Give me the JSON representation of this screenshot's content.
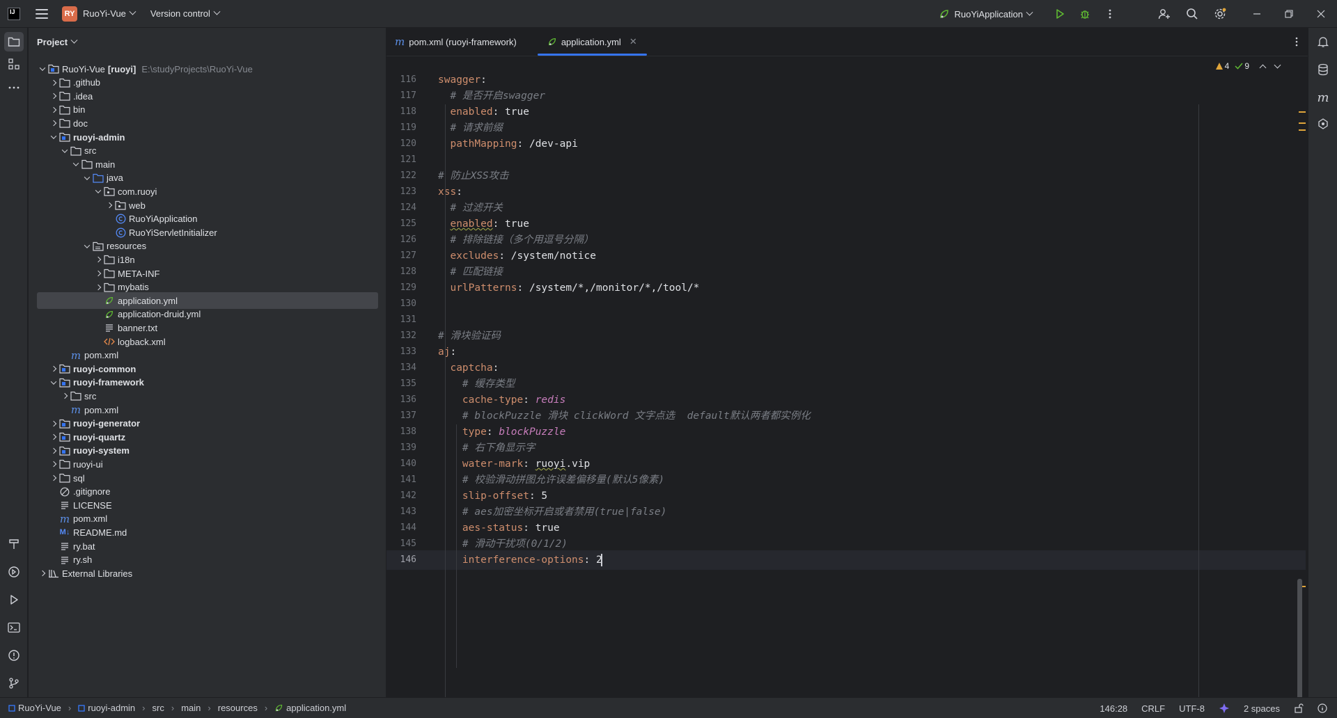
{
  "titlebar": {
    "project_badge": "RY",
    "project_name": "RuoYi-Vue",
    "vcs": "Version control",
    "run_config": "RuoYiApplication"
  },
  "project_panel": {
    "title": "Project",
    "root_name": "RuoYi-Vue",
    "root_module": "[ruoyi]",
    "root_path": "E:\\studyProjects\\RuoYi-Vue",
    "items": [
      {
        "label": ".github",
        "type": "folder"
      },
      {
        "label": ".idea",
        "type": "folder"
      },
      {
        "label": "bin",
        "type": "folder"
      },
      {
        "label": "doc",
        "type": "folder"
      },
      {
        "label": "ruoyi-admin",
        "type": "module"
      },
      {
        "label": "src",
        "type": "folder"
      },
      {
        "label": "main",
        "type": "folder"
      },
      {
        "label": "java",
        "type": "source-folder"
      },
      {
        "label": "com.ruoyi",
        "type": "package"
      },
      {
        "label": "web",
        "type": "package"
      },
      {
        "label": "RuoYiApplication",
        "type": "class"
      },
      {
        "label": "RuoYiServletInitializer",
        "type": "class"
      },
      {
        "label": "resources",
        "type": "resource-folder"
      },
      {
        "label": "i18n",
        "type": "folder"
      },
      {
        "label": "META-INF",
        "type": "folder"
      },
      {
        "label": "mybatis",
        "type": "folder"
      },
      {
        "label": "application.yml",
        "type": "yml"
      },
      {
        "label": "application-druid.yml",
        "type": "yml"
      },
      {
        "label": "banner.txt",
        "type": "text"
      },
      {
        "label": "logback.xml",
        "type": "xml"
      },
      {
        "label": "pom.xml",
        "type": "maven"
      },
      {
        "label": "ruoyi-common",
        "type": "module"
      },
      {
        "label": "ruoyi-framework",
        "type": "module"
      },
      {
        "label": "src",
        "type": "folder"
      },
      {
        "label": "pom.xml",
        "type": "maven"
      },
      {
        "label": "ruoyi-generator",
        "type": "module"
      },
      {
        "label": "ruoyi-quartz",
        "type": "module"
      },
      {
        "label": "ruoyi-system",
        "type": "module"
      },
      {
        "label": "ruoyi-ui",
        "type": "folder"
      },
      {
        "label": "sql",
        "type": "folder"
      },
      {
        "label": ".gitignore",
        "type": "ignore"
      },
      {
        "label": "LICENSE",
        "type": "text"
      },
      {
        "label": "pom.xml",
        "type": "maven"
      },
      {
        "label": "README.md",
        "type": "markdown"
      },
      {
        "label": "ry.bat",
        "type": "text"
      },
      {
        "label": "ry.sh",
        "type": "text"
      },
      {
        "label": "External Libraries",
        "type": "library"
      }
    ]
  },
  "editor": {
    "tabs": [
      {
        "label": "pom.xml (ruoyi-framework)",
        "active": false
      },
      {
        "label": "application.yml",
        "active": true
      }
    ],
    "inspections": {
      "warnings": "4",
      "ok": "9"
    },
    "lines": [
      {
        "n": "116",
        "t": "swagger:"
      },
      {
        "n": "117",
        "t": "  # 是否开启swagger"
      },
      {
        "n": "118",
        "t": "  enabled: true"
      },
      {
        "n": "119",
        "t": "  # 请求前缀"
      },
      {
        "n": "120",
        "t": "  pathMapping: /dev-api"
      },
      {
        "n": "121",
        "t": ""
      },
      {
        "n": "122",
        "t": "# 防止XSS攻击"
      },
      {
        "n": "123",
        "t": "xss:"
      },
      {
        "n": "124",
        "t": "  # 过滤开关"
      },
      {
        "n": "125",
        "t": "  enabled: true"
      },
      {
        "n": "126",
        "t": "  # 排除链接（多个用逗号分隔）"
      },
      {
        "n": "127",
        "t": "  excludes: /system/notice"
      },
      {
        "n": "128",
        "t": "  # 匹配链接"
      },
      {
        "n": "129",
        "t": "  urlPatterns: /system/*,/monitor/*,/tool/*"
      },
      {
        "n": "130",
        "t": ""
      },
      {
        "n": "131",
        "t": ""
      },
      {
        "n": "132",
        "t": "# 滑块验证码"
      },
      {
        "n": "133",
        "t": "aj:"
      },
      {
        "n": "134",
        "t": "  captcha:"
      },
      {
        "n": "135",
        "t": "    # 缓存类型"
      },
      {
        "n": "136",
        "t": "    cache-type: redis"
      },
      {
        "n": "137",
        "t": "    # blockPuzzle 滑块 clickWord 文字点选  default默认两者都实例化"
      },
      {
        "n": "138",
        "t": "    type: blockPuzzle"
      },
      {
        "n": "139",
        "t": "    # 右下角显示字"
      },
      {
        "n": "140",
        "t": "    water-mark: ruoyi.vip"
      },
      {
        "n": "141",
        "t": "    # 校验滑动拼图允许误差偏移量(默认5像素)"
      },
      {
        "n": "142",
        "t": "    slip-offset: 5"
      },
      {
        "n": "143",
        "t": "    # aes加密坐标开启或者禁用(true|false)"
      },
      {
        "n": "144",
        "t": "    aes-status: true"
      },
      {
        "n": "145",
        "t": "    # 滑动干扰项(0/1/2)"
      },
      {
        "n": "146",
        "t": "    interference-options: 2"
      }
    ]
  },
  "statusbar": {
    "crumbs": [
      "RuoYi-Vue",
      "ruoyi-admin",
      "src",
      "main",
      "resources",
      "application.yml"
    ],
    "position": "146:28",
    "line_sep": "CRLF",
    "encoding": "UTF-8",
    "indent": "2 spaces"
  },
  "colors": {
    "accent": "#3574f0",
    "keyword": "#cf8e6d",
    "comment": "#7a7e85",
    "enum_value": "#c77dbb",
    "badge": "#d96c4a"
  }
}
